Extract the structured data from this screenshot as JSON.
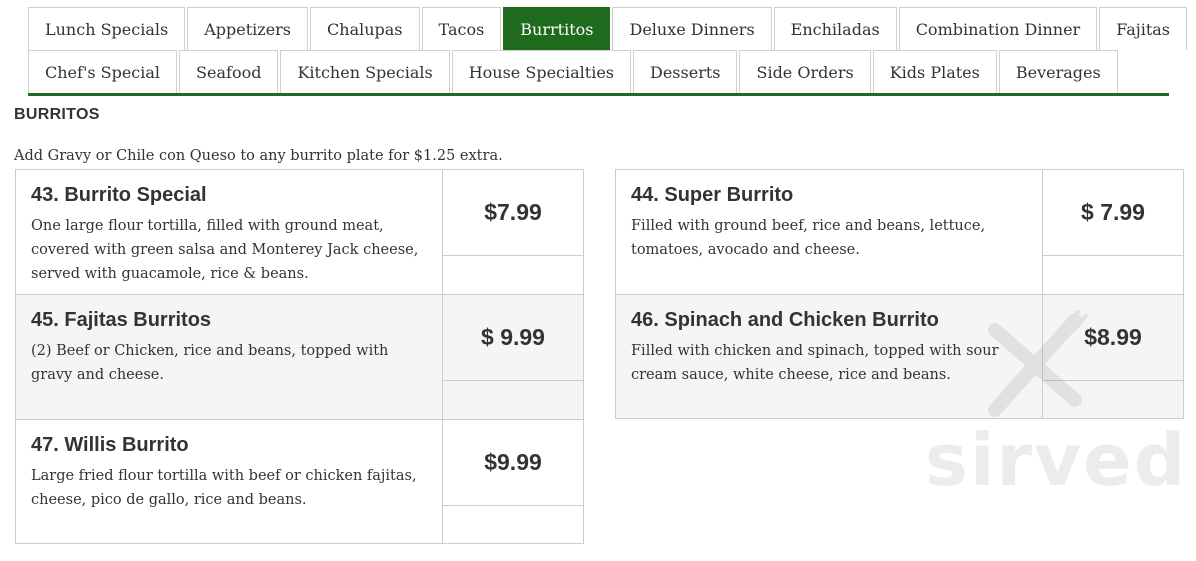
{
  "tabs": {
    "row1": [
      "Lunch Specials",
      "Appetizers",
      "Chalupas",
      "Tacos",
      "Burrtitos",
      "Deluxe Dinners",
      "Enchiladas",
      "Combination Dinner",
      "Fajitas"
    ],
    "row2": [
      "Chef's Special",
      "Seafood",
      "Kitchen Specials",
      "House Specialties",
      "Desserts",
      "Side Orders",
      "Kids Plates",
      "Beverages"
    ],
    "active": "Burrtitos"
  },
  "section": {
    "title": "BURRITOS",
    "note": "Add Gravy or Chile con Queso to any burrito plate for $1.25 extra."
  },
  "items": [
    {
      "name": "43. Burrito Special",
      "desc": "One large flour tortilla, filled with ground meat, covered with green salsa and Monterey Jack cheese, served with guacamole, rice & beans.",
      "price": "$7.99"
    },
    {
      "name": "44. Super Burrito",
      "desc": "Filled with ground beef, rice and beans, lettuce, tomatoes, avocado and cheese.",
      "price": "$ 7.99"
    },
    {
      "name": "45. Fajitas Burritos",
      "desc": "(2) Beef or Chicken, rice and beans, topped with gravy and cheese.",
      "price": "$ 9.99"
    },
    {
      "name": "46. Spinach and Chicken Burrito",
      "desc": "Filled with chicken and spinach, topped with sour cream sauce, white cheese, rice and beans.",
      "price": "$8.99"
    },
    {
      "name": "47. Willis Burrito",
      "desc": "Large fried flour tortilla with beef or chicken fajitas, cheese, pico de gallo, rice and beans.",
      "price": "$9.99"
    }
  ],
  "watermark": {
    "text": "sirved",
    "icon": "fork-knife-icon"
  },
  "colors": {
    "accent": "#1e6b1e",
    "border": "#cccccc",
    "alt_bg": "#f5f5f5"
  }
}
